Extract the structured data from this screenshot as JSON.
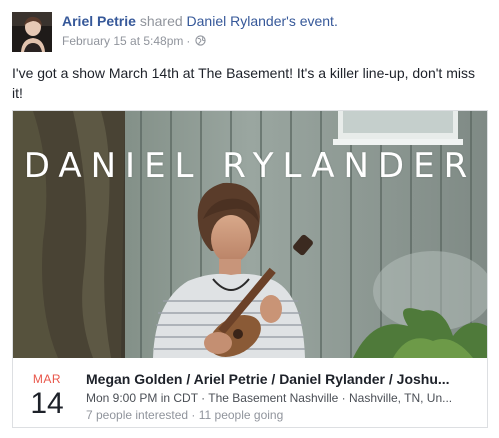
{
  "post": {
    "author": "Ariel Petrie",
    "action": "shared",
    "shared_owner": "Daniel Rylander",
    "shared_object_suffix": "'s event.",
    "timestamp": "February 15 at 5:48pm",
    "separator": "·",
    "privacy_icon": "globe-icon",
    "text": "I've got a show March 14th at The Basement! It's a killer line-up, don't miss it!"
  },
  "event": {
    "cover_title": "DANIEL RYLANDER",
    "month": "MAR",
    "day": "14",
    "name": "Megan Golden / Ariel Petrie / Daniel Rylander / Joshu...",
    "when": "Mon 9:00 PM in CDT · The Basement Nashville · Nashville, TN, Un...",
    "social": "7 people interested · 11 people going"
  },
  "colors": {
    "link": "#365899",
    "muted": "#90949c",
    "month": "#e9564a",
    "border": "#dddfe2"
  }
}
